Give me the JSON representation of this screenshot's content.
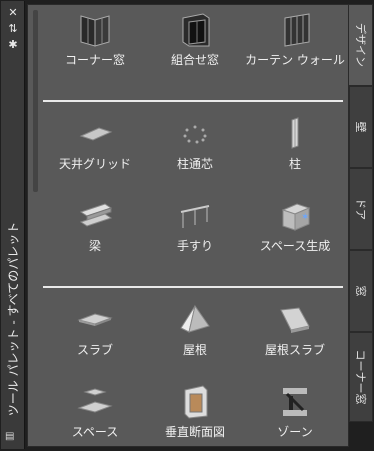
{
  "palette": {
    "title": "ツール パレット - すべてのパレット"
  },
  "tabs": [
    {
      "label": "デザイン",
      "active": true
    },
    {
      "label": "壁"
    },
    {
      "label": "ドア"
    },
    {
      "label": "窓"
    },
    {
      "label": "コーナー窓"
    }
  ],
  "sections": [
    {
      "items": [
        {
          "label": "コーナー窓",
          "icon": "corner-window-icon"
        },
        {
          "label": "組合せ窓",
          "icon": "assembly-window-icon"
        },
        {
          "label": "カーテン ウォール",
          "icon": "curtain-wall-icon"
        }
      ]
    },
    {
      "items": [
        {
          "label": "天井グリッド",
          "icon": "ceiling-grid-icon"
        },
        {
          "label": "柱通芯",
          "icon": "column-grid-icon"
        },
        {
          "label": "柱",
          "icon": "column-icon"
        },
        {
          "label": "梁",
          "icon": "beam-icon"
        },
        {
          "label": "手すり",
          "icon": "railing-icon"
        },
        {
          "label": "スペース生成",
          "icon": "space-generate-icon"
        }
      ]
    },
    {
      "items": [
        {
          "label": "スラブ",
          "icon": "slab-icon"
        },
        {
          "label": "屋根",
          "icon": "roof-icon"
        },
        {
          "label": "屋根スラブ",
          "icon": "roof-slab-icon"
        },
        {
          "label": "スペース",
          "icon": "space-icon"
        },
        {
          "label": "垂直断面図",
          "icon": "vertical-section-icon"
        },
        {
          "label": "ゾーン",
          "icon": "zone-icon"
        }
      ]
    }
  ]
}
